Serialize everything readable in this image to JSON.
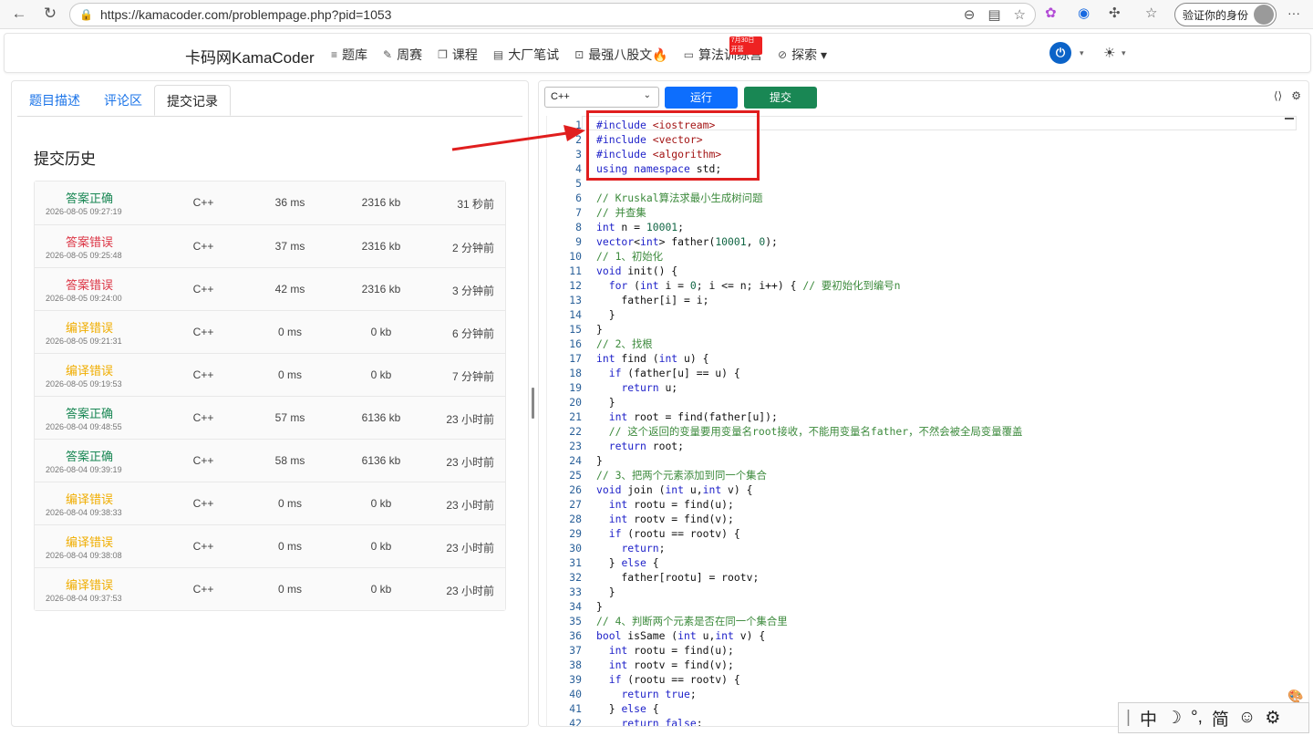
{
  "browser": {
    "url": "https://kamacoder.com/problempage.php?pid=1053",
    "profile_label": "验证你的身份",
    "more": "···"
  },
  "site": {
    "brand": "卡码网KamaCoder",
    "nav": [
      {
        "icon": "≡",
        "label": "题库"
      },
      {
        "icon": "✎",
        "label": "周赛"
      },
      {
        "icon": "❐",
        "label": "课程"
      },
      {
        "icon": "▤",
        "label": "大厂笔试"
      },
      {
        "icon": "⊡",
        "label": "最强八股文🔥"
      },
      {
        "icon": "▭",
        "label": "算法训练营",
        "badge": "7月30日开营"
      },
      {
        "icon": "⊘",
        "label": "探索 ▾"
      }
    ]
  },
  "left": {
    "tabs": [
      "题目描述",
      "评论区",
      "提交记录"
    ],
    "active_tab": 2,
    "history_title": "提交历史",
    "records": [
      {
        "status": "答案正确",
        "kind": "ok",
        "time": "2026-08-05 09:27:19",
        "lang": "C++",
        "runtime": "36 ms",
        "memory": "2316 kb",
        "ago": "31 秒前"
      },
      {
        "status": "答案错误",
        "kind": "wa",
        "time": "2026-08-05 09:25:48",
        "lang": "C++",
        "runtime": "37 ms",
        "memory": "2316 kb",
        "ago": "2 分钟前"
      },
      {
        "status": "答案错误",
        "kind": "wa",
        "time": "2026-08-05 09:24:00",
        "lang": "C++",
        "runtime": "42 ms",
        "memory": "2316 kb",
        "ago": "3 分钟前"
      },
      {
        "status": "编译错误",
        "kind": "ce",
        "time": "2026-08-05 09:21:31",
        "lang": "C++",
        "runtime": "0 ms",
        "memory": "0 kb",
        "ago": "6 分钟前"
      },
      {
        "status": "编译错误",
        "kind": "ce",
        "time": "2026-08-05 09:19:53",
        "lang": "C++",
        "runtime": "0 ms",
        "memory": "0 kb",
        "ago": "7 分钟前"
      },
      {
        "status": "答案正确",
        "kind": "ok",
        "time": "2026-08-04 09:48:55",
        "lang": "C++",
        "runtime": "57 ms",
        "memory": "6136 kb",
        "ago": "23 小时前"
      },
      {
        "status": "答案正确",
        "kind": "ok",
        "time": "2026-08-04 09:39:19",
        "lang": "C++",
        "runtime": "58 ms",
        "memory": "6136 kb",
        "ago": "23 小时前"
      },
      {
        "status": "编译错误",
        "kind": "ce",
        "time": "2026-08-04 09:38:33",
        "lang": "C++",
        "runtime": "0 ms",
        "memory": "0 kb",
        "ago": "23 小时前"
      },
      {
        "status": "编译错误",
        "kind": "ce",
        "time": "2026-08-04 09:38:08",
        "lang": "C++",
        "runtime": "0 ms",
        "memory": "0 kb",
        "ago": "23 小时前"
      },
      {
        "status": "编译错误",
        "kind": "ce",
        "time": "2026-08-04 09:37:53",
        "lang": "C++",
        "runtime": "0 ms",
        "memory": "0 kb",
        "ago": "23 小时前"
      }
    ]
  },
  "editor": {
    "language": "C++",
    "run_label": "运行",
    "submit_label": "提交",
    "lines": [
      "#include <iostream>",
      "#include <vector>",
      "#include <algorithm>",
      "using namespace std;",
      "",
      "// Kruskal算法求最小生成树问题",
      "// 并查集",
      "int n = 10001;",
      "vector<int> father(10001, 0);",
      "// 1、初始化",
      "void init() {",
      "  for (int i = 0; i <= n; i++) { // 要初始化到编号n",
      "    father[i] = i;",
      "  }",
      "}",
      "// 2、找根",
      "int find (int u) {",
      "  if (father[u] == u) {",
      "    return u;",
      "  }",
      "  int root = find(father[u]);",
      "  // 这个返回的变量要用变量名root接收，不能用变量名father，不然会被全局变量覆盖",
      "  return root;",
      "}",
      "// 3、把两个元素添加到同一个集合",
      "void join (int u,int v) {",
      "  int rootu = find(u);",
      "  int rootv = find(v);",
      "  if (rootu == rootv) {",
      "    return;",
      "  } else {",
      "    father[rootu] = rootv;",
      "  }",
      "}",
      "// 4、判断两个元素是否在同一个集合里",
      "bool isSame (int u,int v) {",
      "  int rootu = find(u);",
      "  int rootv = find(v);",
      "  if (rootu == rootv) {",
      "    return true;",
      "  } else {",
      "    return false;"
    ]
  },
  "ime": [
    "中",
    "☽",
    "°,",
    "简",
    "☺",
    "⚙"
  ]
}
